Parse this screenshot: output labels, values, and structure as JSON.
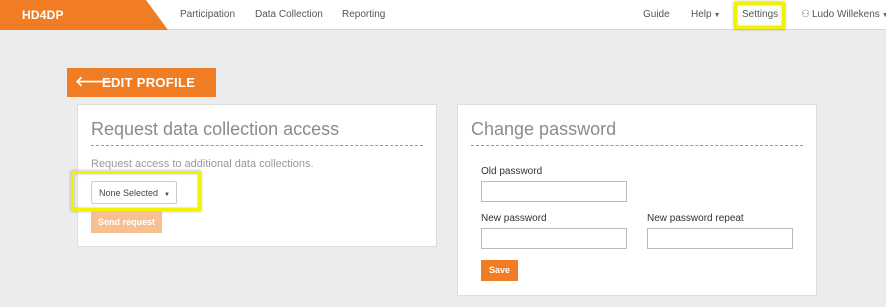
{
  "app": {
    "brand": "HD4DP"
  },
  "nav": {
    "left": [
      {
        "label": "Participation"
      },
      {
        "label": "Data Collection"
      },
      {
        "label": "Reporting"
      }
    ],
    "guide": "Guide",
    "help": "Help",
    "settings": "Settings",
    "user": "Ludo Willekens"
  },
  "header": {
    "title": "EDIT PROFILE"
  },
  "request_panel": {
    "title": "Request data collection access",
    "description": "Request access to additional data collections.",
    "select_value": "None Selected",
    "send_label": "Send request"
  },
  "password_panel": {
    "title": "Change password",
    "old_label": "Old password",
    "new_label": "New password",
    "repeat_label": "New password repeat",
    "save_label": "Save"
  },
  "colors": {
    "accent": "#f07d23",
    "accent_disabled": "#f7c093",
    "highlight": "#f2f200"
  }
}
